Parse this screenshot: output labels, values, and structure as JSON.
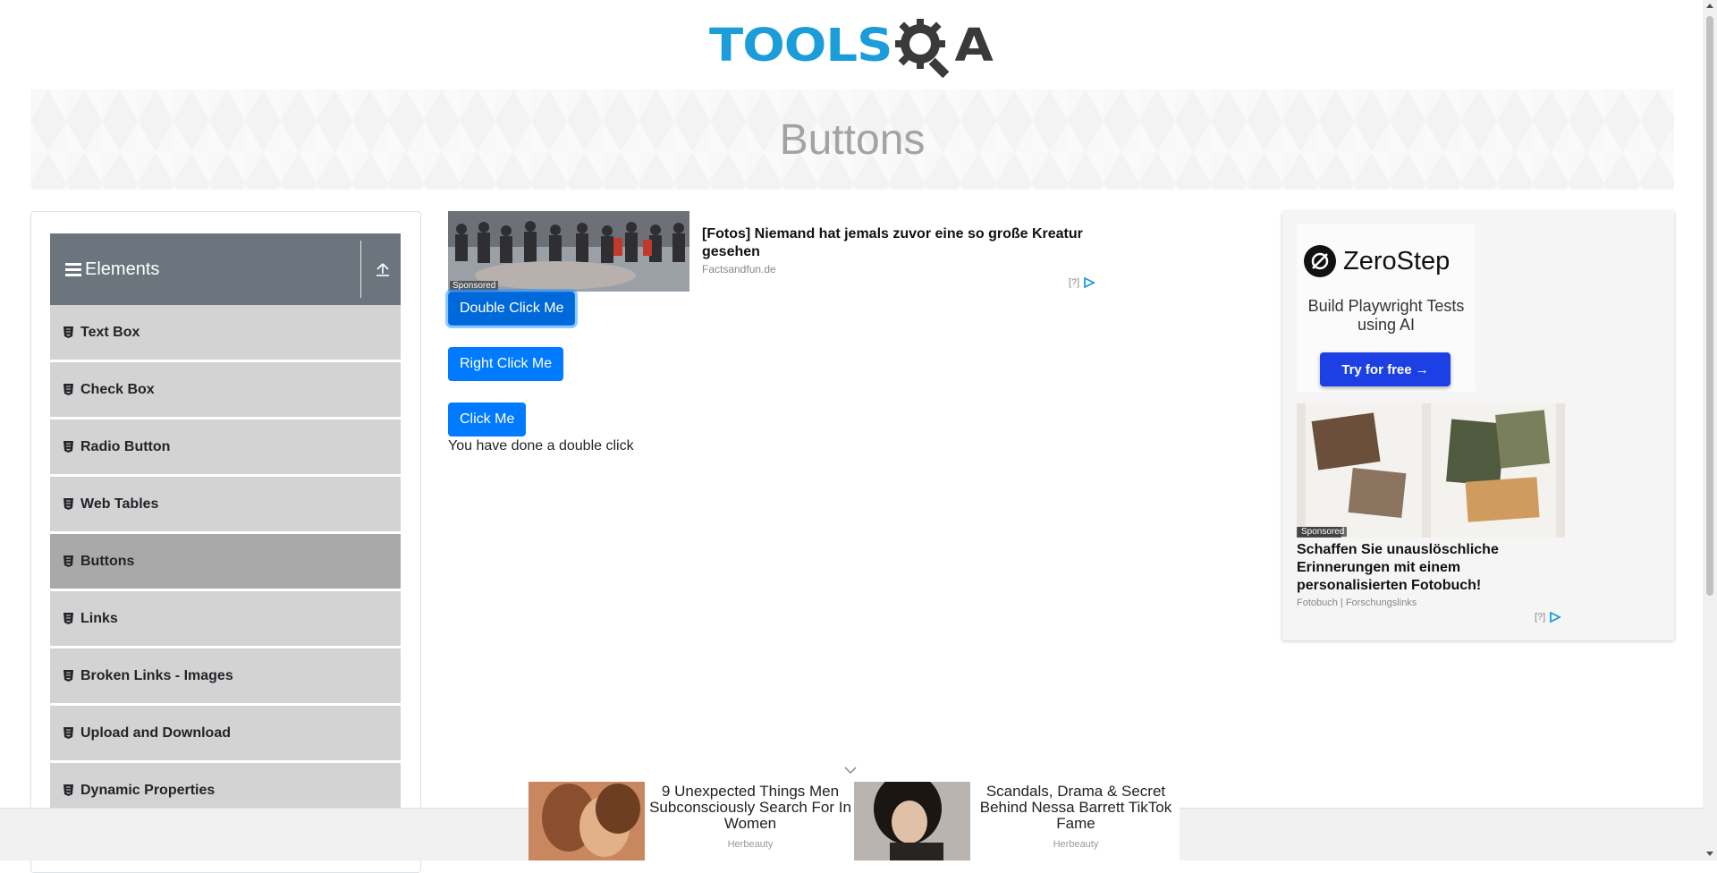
{
  "header": {
    "logo_text": "TOOLS",
    "logo_suffix": "A",
    "logo_color": "#1a9dd9"
  },
  "banner": {
    "title": "Buttons"
  },
  "sidebar": {
    "group_title": "Elements",
    "group_icon": "hamburger-icon",
    "collapse_icon": "upload-arrow-icon",
    "items": [
      {
        "label": "Text Box",
        "active": false
      },
      {
        "label": "Check Box",
        "active": false
      },
      {
        "label": "Radio Button",
        "active": false
      },
      {
        "label": "Web Tables",
        "active": false
      },
      {
        "label": "Buttons",
        "active": true
      },
      {
        "label": "Links",
        "active": false
      },
      {
        "label": "Broken Links - Images",
        "active": false
      },
      {
        "label": "Upload and Download",
        "active": false
      },
      {
        "label": "Dynamic Properties",
        "active": false
      }
    ],
    "item_icon": "html5-shield-icon"
  },
  "ad_top": {
    "sponsored": "Sponsored",
    "headline": "[Fotos] Niemand hat jemals zuvor eine so große Kreatur gesehen",
    "source": "Factsandfun.de",
    "choice": "[?]"
  },
  "buttons": {
    "double_click": "Double Click Me",
    "right_click": "Right Click Me",
    "click": "Click Me",
    "message": "You have done a double click",
    "primary_color": "#007bff"
  },
  "right_ad": {
    "brand": "ZeroStep",
    "tagline": "Build Playwright Tests using AI",
    "cta": "Try for free →",
    "sponsored": "Sponsored",
    "title": "Schaffen Sie unauslöschliche Erinnerungen mit einem personalisierten Fotobuch!",
    "source": "Fotobuch | Forschungslinks",
    "choice": "[?]"
  },
  "bottom_ads": [
    {
      "text": "9 Unexpected Things Men Subconsciously Search For In Women",
      "source": "Herbeauty"
    },
    {
      "text": "Scandals, Drama & Secret Behind Nessa Barrett TikTok Fame",
      "source": "Herbeauty"
    }
  ]
}
